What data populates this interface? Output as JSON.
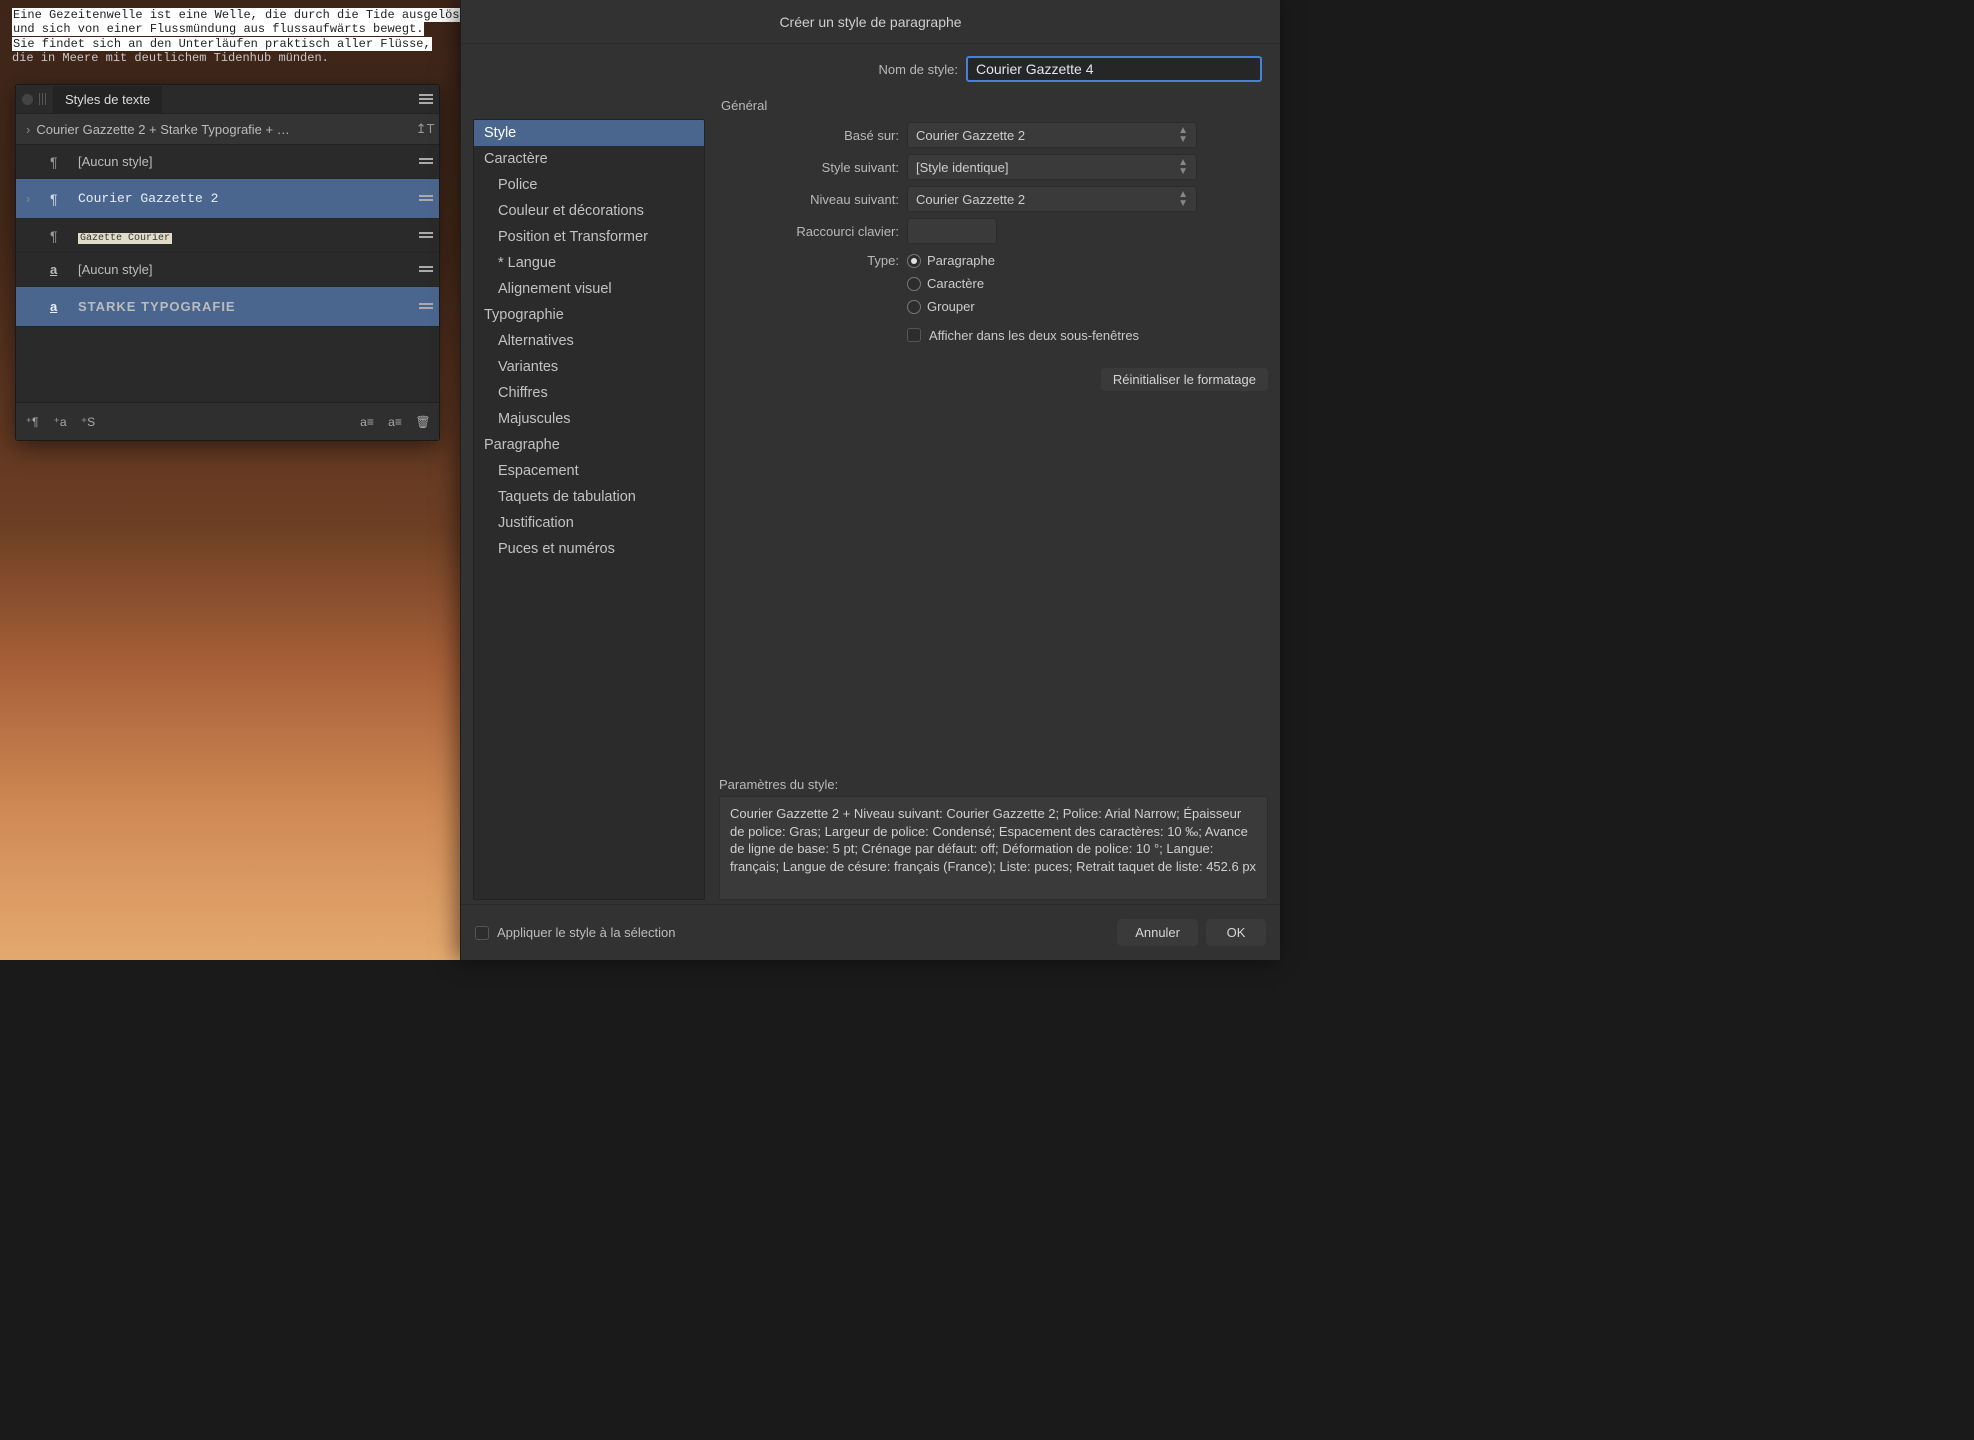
{
  "back_text": {
    "l1": "Eine Gezeitenwelle ist eine Welle, die durch die Tide ausgelöst wird",
    "l2": "und sich von einer Flussmündung aus flussaufwärts bewegt.",
    "l3": "Sie findet sich an den Unterläufen praktisch aller Flüsse,",
    "l4": "die in Meere mit deutlichem Tidenhub münden."
  },
  "palette": {
    "tab": "Styles de texte",
    "breadcrumb": "Courier Gazzette 2 + Starke Typografie + …",
    "rows": {
      "none1": "[Aucun style]",
      "courier": "Courier Gazzette 2",
      "gazette": "Gazette Courier",
      "none2": "[Aucun style]",
      "strong": "STARKE TYPOGRAFIE"
    },
    "footer_icons": {
      "p": "¶",
      "a": "a",
      "s": "S"
    }
  },
  "dialog": {
    "title": "Créer un style de paragraphe",
    "categories": {
      "style": "Style",
      "caractere": "Caractère",
      "police": "Police",
      "couleur": "Couleur et décorations",
      "position": "Position et Transformer",
      "langue": "* Langue",
      "align": "Alignement visuel",
      "typo": "Typographie",
      "alt": "Alternatives",
      "variantes": "Variantes",
      "chiffres": "Chiffres",
      "maj": "Majuscules",
      "paragraphe": "Paragraphe",
      "espacement": "Espacement",
      "taquets": "Taquets de tabulation",
      "justif": "Justification",
      "puces": "Puces et numéros"
    },
    "labels": {
      "nom": "Nom de style:",
      "general": "Général",
      "base": "Basé sur:",
      "suivant": "Style suivant:",
      "niveau": "Niveau suivant:",
      "raccourci": "Raccourci clavier:",
      "type": "Type:",
      "afficher": "Afficher dans les deux sous-fenêtres",
      "reset": "Réinitialiser le formatage",
      "params": "Paramètres du style:",
      "apply": "Appliquer le style à la sélection",
      "cancel": "Annuler",
      "ok": "OK"
    },
    "values": {
      "nom": "Courier Gazzette 4",
      "base": "Courier Gazzette 2",
      "suivant": "[Style identique]",
      "niveau": "Courier Gazzette 2"
    },
    "type_options": {
      "p": "Paragraphe",
      "c": "Caractère",
      "g": "Grouper"
    },
    "params_text": "Courier Gazzette 2 + Niveau suivant: Courier Gazzette 2; Police: Arial Narrow; Épaisseur de police: Gras; Largeur de police: Condensé; Espacement des caractères: 10 ‰; Avance de ligne de base: 5 pt; Crénage par défaut: off; Déformation de police: 10 °; Langue: français; Langue de césure: français (France); Liste: puces; Retrait taquet de liste: 452.6 px"
  }
}
